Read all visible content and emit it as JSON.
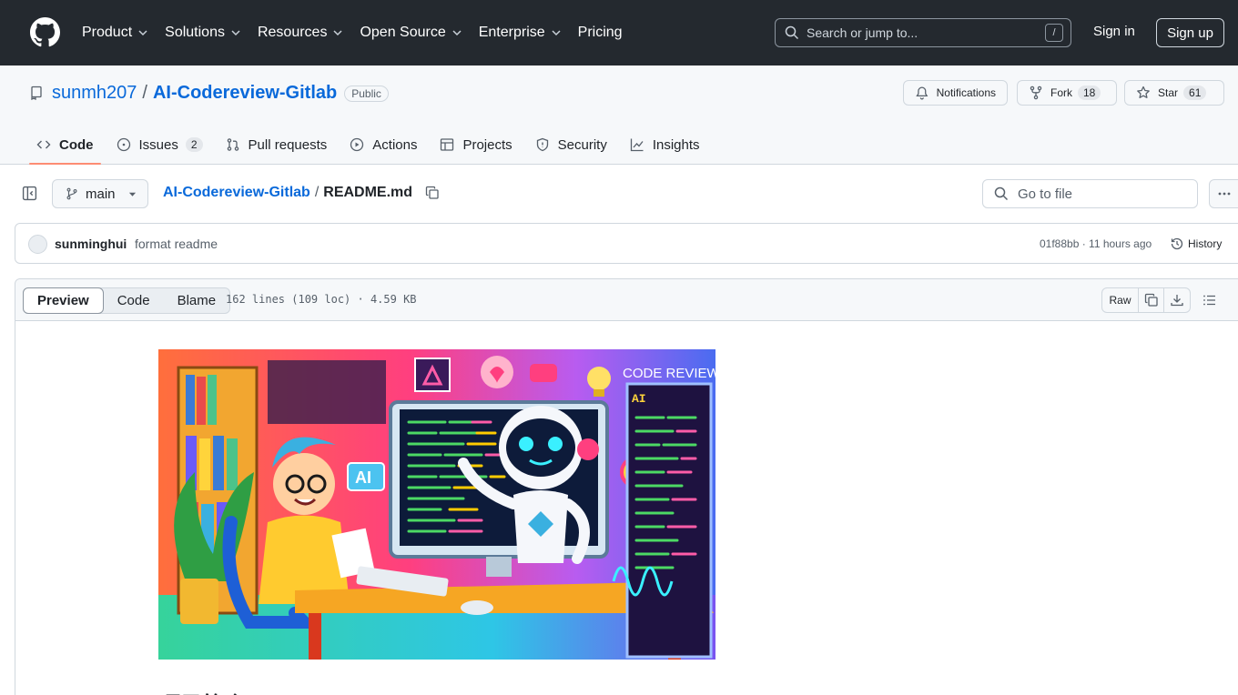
{
  "header": {
    "nav": [
      "Product",
      "Solutions",
      "Resources",
      "Open Source",
      "Enterprise",
      "Pricing"
    ],
    "nav_has_menu": [
      true,
      true,
      true,
      true,
      true,
      false
    ],
    "search_placeholder": "Search or jump to...",
    "search_shortcut": "/",
    "sign_in": "Sign in",
    "sign_up": "Sign up"
  },
  "repo": {
    "owner": "sunmh207",
    "separator": "/",
    "name": "AI-Codereview-Gitlab",
    "visibility": "Public",
    "notifications_label": "Notifications",
    "fork_label": "Fork",
    "fork_count": "18",
    "star_label": "Star",
    "star_count": "61"
  },
  "tabs": [
    {
      "label": "Code",
      "active": true,
      "icon": "code-icon"
    },
    {
      "label": "Issues",
      "count": "2",
      "icon": "issue-icon"
    },
    {
      "label": "Pull requests",
      "icon": "pull-request-icon"
    },
    {
      "label": "Actions",
      "icon": "play-icon"
    },
    {
      "label": "Projects",
      "icon": "table-icon"
    },
    {
      "label": "Security",
      "icon": "shield-icon"
    },
    {
      "label": "Insights",
      "icon": "graph-icon"
    }
  ],
  "filebar": {
    "branch": "main",
    "crumb_repo": "AI-Codereview-Gitlab",
    "crumb_sep": "/",
    "crumb_file": "README.md",
    "goto_placeholder": "Go to file"
  },
  "commit": {
    "author": "sunminghui",
    "message": "format readme",
    "meta": "01f88bb · 11 hours ago",
    "history": "History"
  },
  "file": {
    "views": [
      "Preview",
      "Code",
      "Blame"
    ],
    "selected_view": "Preview",
    "info": "162 lines (109 loc) · 4.59 KB",
    "raw": "Raw"
  },
  "readme": {
    "hero_text_1": "CODE REVIEW",
    "hero_text_2": "AI",
    "heading": "项目简介"
  },
  "colors": {
    "header_bg": "#24292f",
    "link": "#0969da",
    "active_tab_underline": "#fd8c73"
  }
}
